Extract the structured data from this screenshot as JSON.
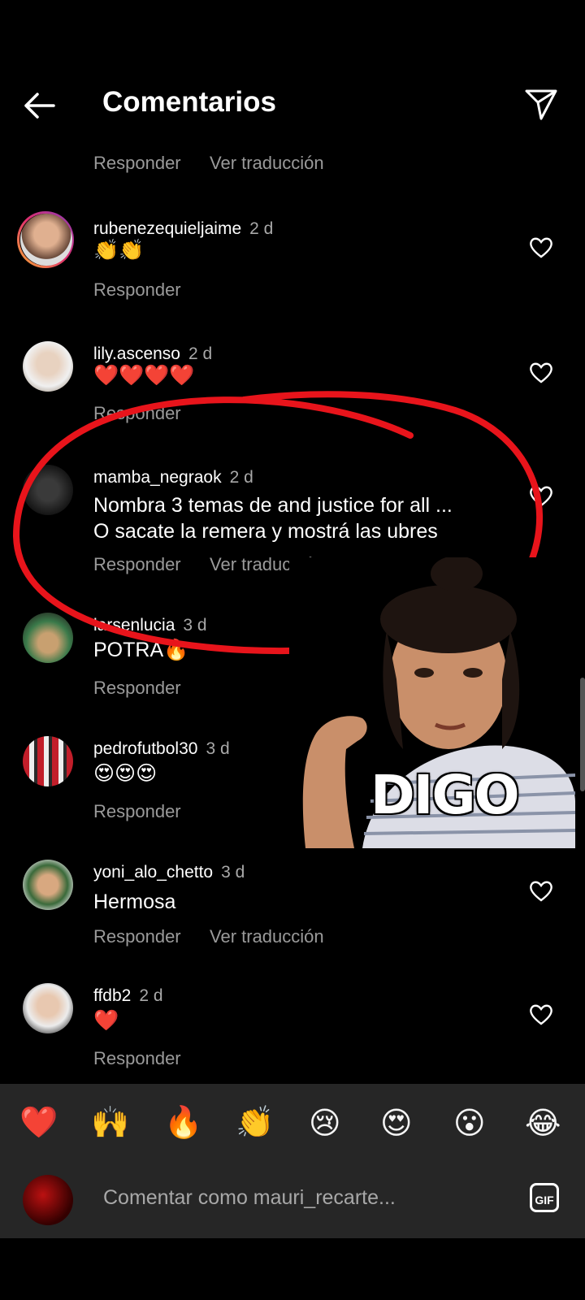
{
  "header": {
    "title": "Comentarios"
  },
  "first_actions": {
    "reply": "Responder",
    "translate": "Ver traducción"
  },
  "comments": [
    {
      "user": "rubenezequieljaime",
      "time": "2 d",
      "text": "👏👏",
      "reply": "Responder"
    },
    {
      "user": "lily.ascenso",
      "time": "2 d",
      "text": "❤️❤️❤️❤️",
      "reply": "Responder"
    },
    {
      "user": "mamba_negraok",
      "time": "2 d",
      "text1": "Nombra 3 temas de and justice for all ...",
      "text2": "O sacate la remera y mostrá las ubres",
      "reply": "Responder",
      "translate": "Ver traducción"
    },
    {
      "user": "larsenlucia",
      "time": "3 d",
      "text": "POTRA🔥",
      "reply": "Responder"
    },
    {
      "user": "pedrofutbol30",
      "time": "3 d",
      "text": "😍😍😍",
      "reply": "Responder"
    },
    {
      "user": "yoni_alo_chetto",
      "time": "3 d",
      "text": "Hermosa",
      "reply": "Responder",
      "translate": "Ver traducción"
    },
    {
      "user": "ffdb2",
      "time": "2 d",
      "text": "❤️",
      "reply": "Responder"
    }
  ],
  "emoji_bar": [
    "❤️",
    "🙌",
    "🔥",
    "👏",
    "😢",
    "😍",
    "😮",
    "😂"
  ],
  "input": {
    "placeholder": "Comentar como mauri_recarte...",
    "gif_label": "GIF"
  },
  "meme": {
    "caption": "DIGO"
  },
  "colors": {
    "background": "#000000",
    "annotation_red": "#e8141b"
  }
}
